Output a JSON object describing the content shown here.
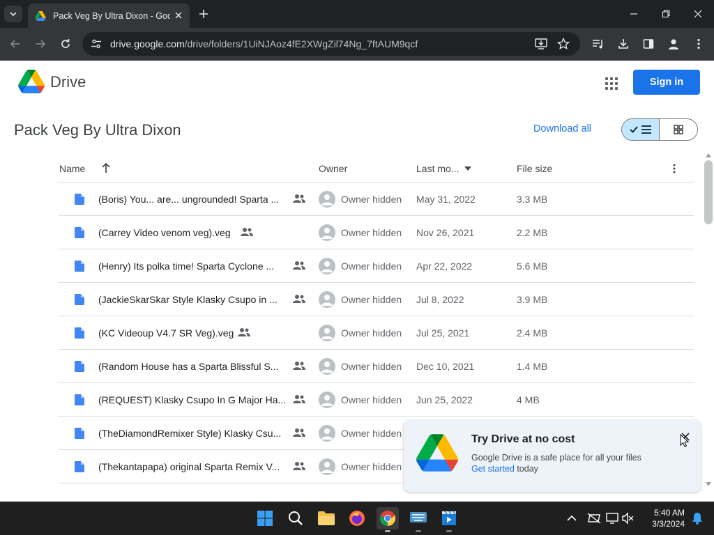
{
  "browser": {
    "tab_title": "Pack Veg By Ultra Dixon - Goog",
    "url_host": "drive.google.com",
    "url_path": "/drive/folders/1UiNJAoz4fE2XWgZil74Ng_7ftAUM9qcf"
  },
  "header": {
    "product_name": "Drive",
    "signin_label": "Sign in"
  },
  "folder": {
    "title": "Pack Veg By Ultra Dixon",
    "download_all_label": "Download all"
  },
  "table": {
    "columns": {
      "name": "Name",
      "owner": "Owner",
      "modified": "Last mo...",
      "size": "File size"
    },
    "rows": [
      {
        "name": "(Boris) You... are... ungrounded! Sparta ...",
        "owner": "Owner hidden",
        "modified": "May 31, 2022",
        "size": "3.3 MB"
      },
      {
        "name": "(Carrey Video venom veg).veg",
        "owner": "Owner hidden",
        "modified": "Nov 26, 2021",
        "size": "2.2 MB"
      },
      {
        "name": "(Henry) Its polka time! Sparta Cyclone ...",
        "owner": "Owner hidden",
        "modified": "Apr 22, 2022",
        "size": "5.6 MB"
      },
      {
        "name": "(JackieSkarSkar Style Klasky Csupo in ...",
        "owner": "Owner hidden",
        "modified": "Jul 8, 2022",
        "size": "3.9 MB"
      },
      {
        "name": "(KC Videoup V4.7 SR Veg).veg",
        "owner": "Owner hidden",
        "modified": "Jul 25, 2021",
        "size": "2.4 MB"
      },
      {
        "name": "(Random House has a Sparta Blissful S...",
        "owner": "Owner hidden",
        "modified": "Dec 10, 2021",
        "size": "1.4 MB"
      },
      {
        "name": "(REQUEST) Klasky Csupo In G Major Ha...",
        "owner": "Owner hidden",
        "modified": "Jun 25, 2022",
        "size": "4 MB"
      },
      {
        "name": "(TheDiamondRemixer Style) Klasky Csu...",
        "owner": "Owner hidden",
        "modified": "",
        "size": ""
      },
      {
        "name": "(Thekantapapa) original Sparta Remix V...",
        "owner": "Owner hidden",
        "modified": "",
        "size": ""
      }
    ]
  },
  "promo": {
    "title": "Try Drive at no cost",
    "description": "Google Drive is a safe place for all your files",
    "link": "Get started",
    "suffix": " today"
  },
  "taskbar": {
    "time": "5:40 AM",
    "date": "3/3/2024"
  },
  "colors": {
    "accent": "#1a73e8",
    "toggle_active": "#c2e7ff"
  }
}
